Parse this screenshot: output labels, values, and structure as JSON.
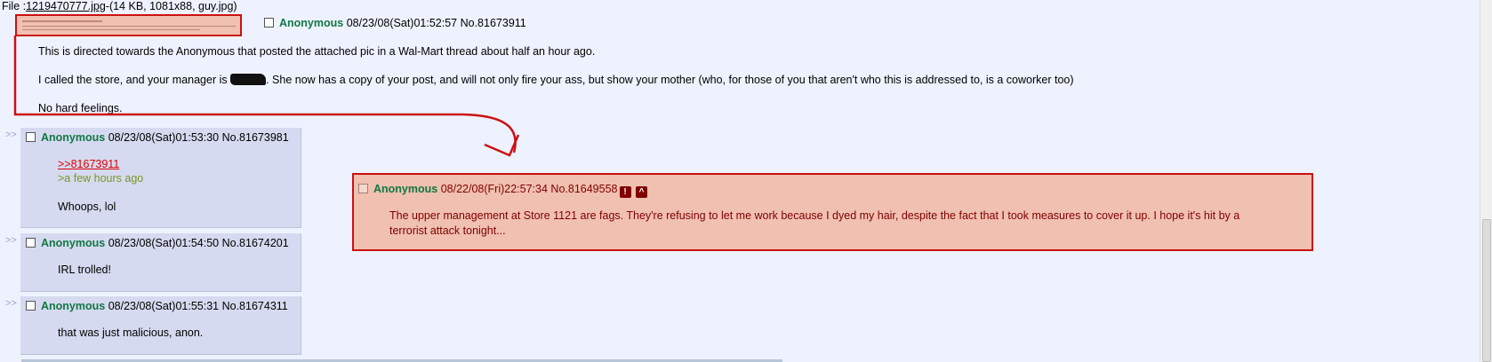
{
  "file": {
    "prefix": "File :",
    "link": "1219470777.jpg",
    "meta": "-(14 KB, 1081x88, guy.jpg)"
  },
  "op": {
    "name": "Anonymous",
    "datetime": "08/23/08(Sat)01:52:57",
    "postno": "No.81673911",
    "line1": "This is directed towards the Anonymous that posted the attached pic in a Wal-Mart thread about half an hour ago.",
    "line2_before": "I called the store, and your manager is",
    "line2_after": ". She now has a copy of your post, and will not only fire your ass, but show your mother (who, for those of you that aren't who this is addressed to, is a coworker too)",
    "line3": "No hard feelings."
  },
  "replies": [
    {
      "arrow": ">>",
      "name": "Anonymous",
      "datetime": "08/23/08(Sat)01:53:30",
      "postno": "No.81673981",
      "quote_link": ">>81673911",
      "greentext": ">a few hours ago",
      "body": "Whoops, lol"
    },
    {
      "arrow": ">>",
      "name": "Anonymous",
      "datetime": "08/23/08(Sat)01:54:50",
      "postno": "No.81674201",
      "body": "IRL trolled!"
    },
    {
      "arrow": ">>",
      "name": "Anonymous",
      "datetime": "08/23/08(Sat)01:55:31",
      "postno": "No.81674311",
      "body": "that was just malicious, anon."
    }
  ],
  "quoted_post": {
    "name": "Anonymous",
    "datetime": "08/22/08(Fri)22:57:34",
    "postno": "No.81649558",
    "icon1": "!",
    "icon2": "^",
    "body": "The upper management at Store 1121 are fags. They're refusing to let me work because I dyed my hair, despite the fact that I took measures to cover it up. I hope it's hit by a terrorist attack tonight..."
  },
  "colors": {
    "annotation_red": "#cc1111",
    "name_green": "#117743",
    "quote_bg": "#f0c0b0",
    "reply_bg": "#d6daf0",
    "page_bg": "#eef2ff"
  }
}
